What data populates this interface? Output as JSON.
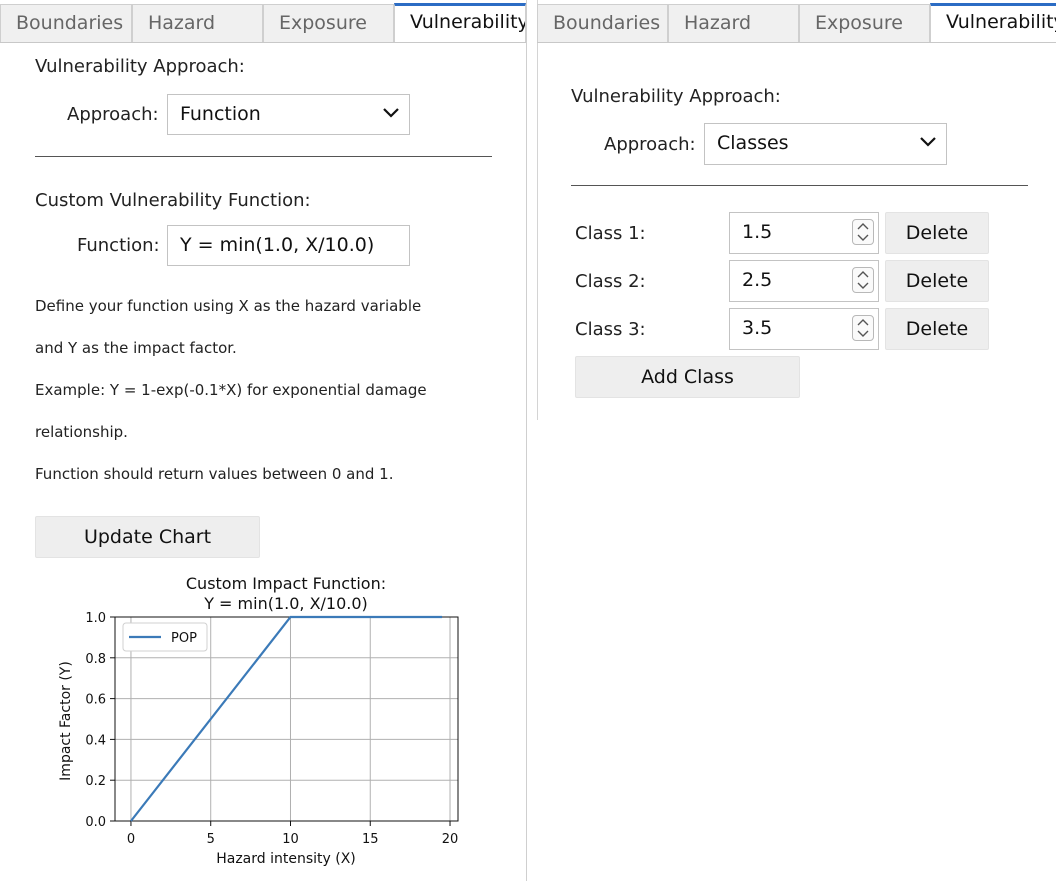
{
  "left": {
    "tabs": [
      {
        "label": "Boundaries"
      },
      {
        "label": "Hazard"
      },
      {
        "label": "Exposure"
      },
      {
        "label": "Vulnerability"
      }
    ],
    "section_title": "Vulnerability Approach:",
    "approach_label": "Approach:",
    "approach_value": "Function",
    "custom_title": "Custom Vulnerability Function:",
    "function_label": "Function:",
    "function_value": "Y = min(1.0, X/10.0)",
    "help_lines": [
      "Define your function using X as the hazard variable",
      "and Y as the impact factor.",
      "Example: Y = 1-exp(-0.1*X) for exponential damage",
      "relationship.",
      "Function should return values between 0 and 1."
    ],
    "update_button": "Update Chart"
  },
  "right": {
    "tabs": [
      {
        "label": "Boundaries"
      },
      {
        "label": "Hazard"
      },
      {
        "label": "Exposure"
      },
      {
        "label": "Vulnerability"
      }
    ],
    "section_title": "Vulnerability Approach:",
    "approach_label": "Approach:",
    "approach_value": "Classes",
    "classes": [
      {
        "label": "Class 1:",
        "value": "1.5",
        "delete": "Delete"
      },
      {
        "label": "Class 2:",
        "value": "2.5",
        "delete": "Delete"
      },
      {
        "label": "Class 3:",
        "value": "3.5",
        "delete": "Delete"
      }
    ],
    "add_button": "Add Class"
  },
  "chart_data": {
    "type": "line",
    "title": "Custom Impact Function:",
    "subtitle": "Y = min(1.0, X/10.0)",
    "xlabel": "Hazard intensity (X)",
    "ylabel": "Impact Factor (Y)",
    "xlim": [
      -1,
      20.5
    ],
    "ylim": [
      0,
      1.0
    ],
    "xticks": [
      0,
      5,
      10,
      15,
      20
    ],
    "yticks": [
      0.0,
      0.2,
      0.4,
      0.6,
      0.8,
      1.0
    ],
    "ytick_labels": [
      "0.0",
      "0.2",
      "0.4",
      "0.6",
      "0.8",
      "1.0"
    ],
    "grid": true,
    "legend_position": "upper-left",
    "series": [
      {
        "name": "POP",
        "color": "#3b7ab8",
        "x": [
          0,
          10,
          19.5
        ],
        "y": [
          0.0,
          1.0,
          1.0
        ]
      }
    ]
  },
  "colors": {
    "accent": "#2b6cc4",
    "line": "#3b7ab8"
  }
}
